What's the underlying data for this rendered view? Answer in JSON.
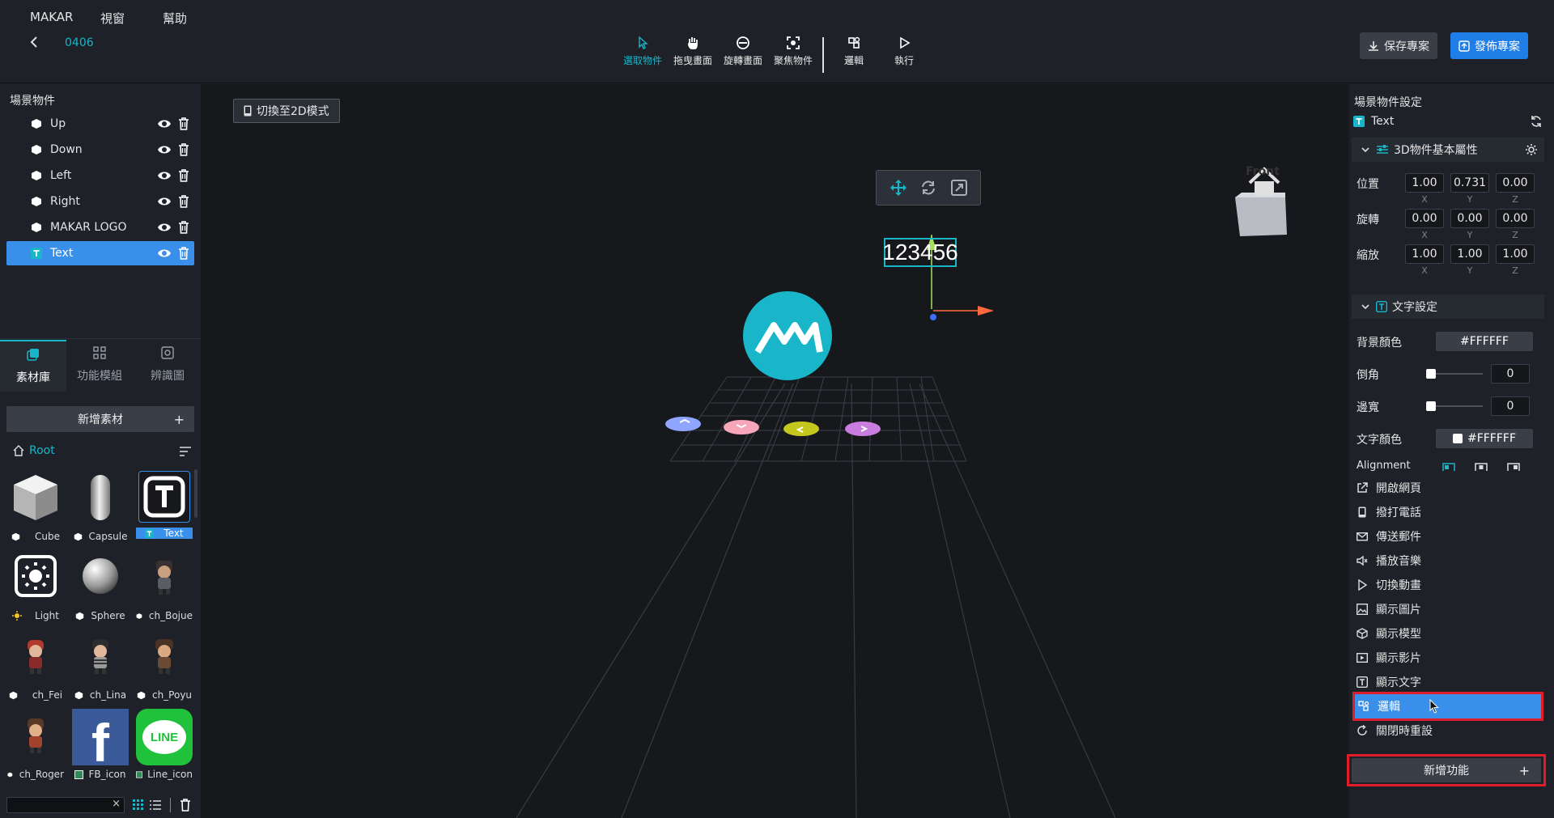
{
  "menu": {
    "items": [
      "MAKAR",
      "視窗",
      "幫助"
    ]
  },
  "project": {
    "name": "0406"
  },
  "toolbar": {
    "tools": [
      {
        "label": "選取物件",
        "icon": "cursor-icon",
        "active": true
      },
      {
        "label": "拖曳畫面",
        "icon": "hand-icon",
        "active": false
      },
      {
        "label": "旋轉畫面",
        "icon": "rotate-view-icon",
        "active": false
      },
      {
        "label": "聚焦物件",
        "icon": "focus-icon",
        "active": false
      },
      {
        "label": "邏輯",
        "icon": "logic-icon",
        "active": false
      },
      {
        "label": "執行",
        "icon": "play-icon",
        "active": false
      }
    ],
    "save_label": "保存專案",
    "publish_label": "發佈專案"
  },
  "scene": {
    "title": "場景物件",
    "items": [
      {
        "label": "Up",
        "icon": "cube-icon"
      },
      {
        "label": "Down",
        "icon": "cube-icon"
      },
      {
        "label": "Left",
        "icon": "cube-icon"
      },
      {
        "label": "Right",
        "icon": "cube-icon"
      },
      {
        "label": "MAKAR LOGO",
        "icon": "cube-icon"
      },
      {
        "label": "Text",
        "icon": "text-icon",
        "selected": true
      }
    ]
  },
  "library": {
    "tabs": [
      "素材庫",
      "功能模組",
      "辨識圖"
    ],
    "add_label": "新增素材",
    "add_symbol": "+",
    "root_label": "Root",
    "assets": [
      {
        "label": "Cube"
      },
      {
        "label": "Capsule"
      },
      {
        "label": "Text",
        "selected": true
      },
      {
        "label": "Light"
      },
      {
        "label": "Sphere"
      },
      {
        "label": "ch_Bojue"
      },
      {
        "label": "ch_Fei"
      },
      {
        "label": "ch_Lina"
      },
      {
        "label": "ch_Poyu"
      },
      {
        "label": "ch_Roger"
      },
      {
        "label": "FB_icon"
      },
      {
        "label": "Line_icon"
      }
    ],
    "fb_glyph": "f",
    "line_glyph": "LINE",
    "search_clear": "×"
  },
  "viewport": {
    "mode_button": "切換至2D模式",
    "gizmo_front": "Front",
    "text_object": "123456"
  },
  "settings": {
    "title": "場景物件設定",
    "object_name": "Text",
    "basic_section": "3D物件基本屬性",
    "position_label": "位置",
    "rotation_label": "旋轉",
    "scale_label": "縮放",
    "position": [
      "1.00",
      "0.731",
      "0.00"
    ],
    "rotation": [
      "0.00",
      "0.00",
      "0.00"
    ],
    "scale": [
      "1.00",
      "1.00",
      "1.00"
    ],
    "axes": [
      "X",
      "Y",
      "Z"
    ],
    "text_section": "文字設定",
    "bg_color_label": "背景顏色",
    "bg_color": "#FFFFFF",
    "corner_label": "倒角",
    "corner_value": "0",
    "border_label": "邊寬",
    "border_value": "0",
    "text_color_label": "文字顏色",
    "text_color": "#FFFFFF",
    "alignment_label": "Alignment"
  },
  "functions": {
    "items": [
      {
        "label": "開啟網頁",
        "icon": "external-link-icon"
      },
      {
        "label": "撥打電話",
        "icon": "phone-icon"
      },
      {
        "label": "傳送郵件",
        "icon": "mail-icon"
      },
      {
        "label": "播放音樂",
        "icon": "speaker-icon"
      },
      {
        "label": "切換動畫",
        "icon": "play-icon"
      },
      {
        "label": "顯示圖片",
        "icon": "image-icon"
      },
      {
        "label": "顯示模型",
        "icon": "model-icon"
      },
      {
        "label": "顯示影片",
        "icon": "video-icon"
      },
      {
        "label": "顯示文字",
        "icon": "text-icon"
      },
      {
        "label": "邏輯",
        "icon": "logic-icon",
        "selected": true
      },
      {
        "label": "關閉時重設",
        "icon": "reset-icon"
      }
    ],
    "add_label": "新增功能",
    "add_symbol": "+"
  },
  "colors": {
    "accent": "#19b6c9",
    "selected": "#3a8fea",
    "highlight": "#e01e2b",
    "publish": "#1f7ee8"
  }
}
